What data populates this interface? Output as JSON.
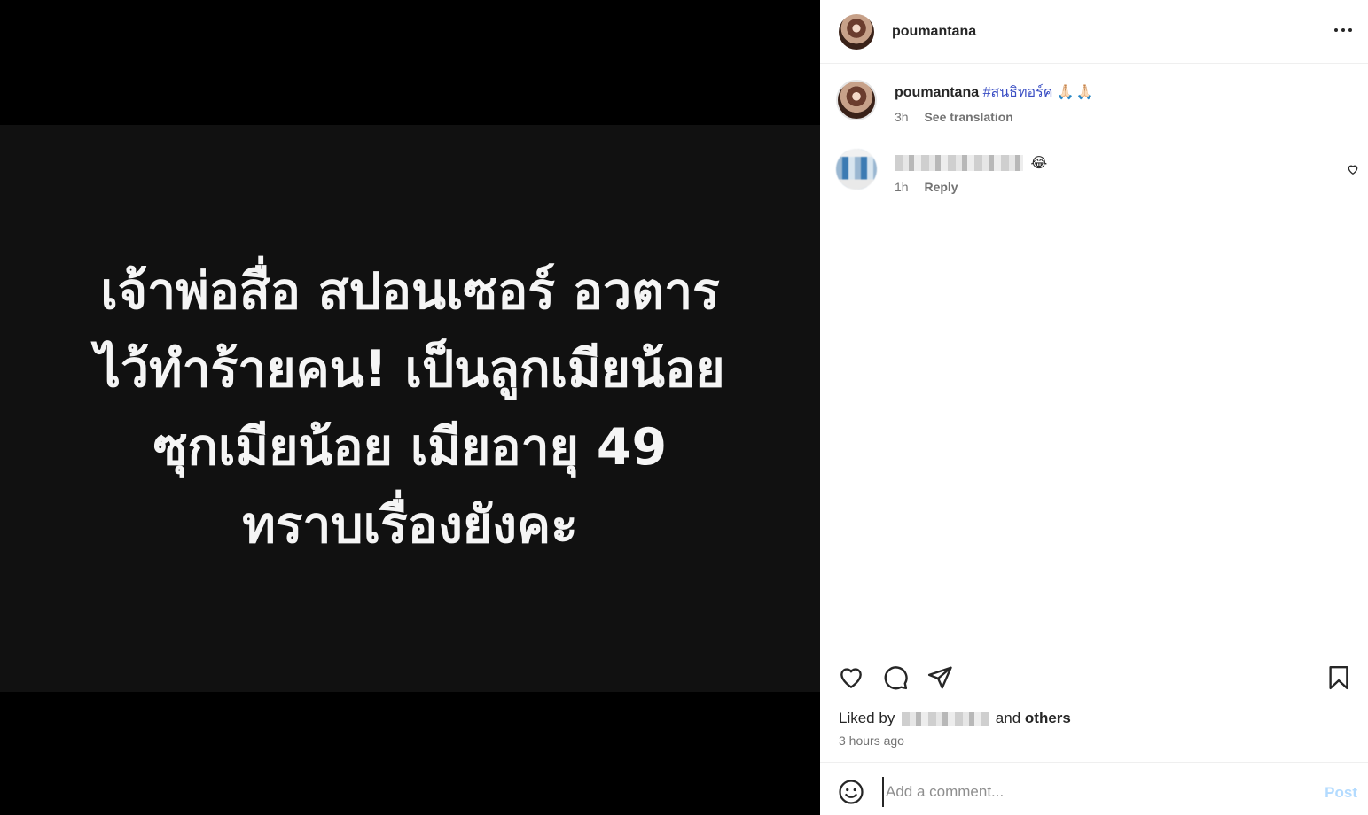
{
  "post": {
    "image_text": [
      "เจ้าพ่อสื่อ สปอนเซอร์ อวตาร",
      "ไว้ทำร้ายคน! เป็นลูกเมียน้อย",
      "ซุกเมียน้อย เมียอายุ 49",
      "ทราบเรื่องยังคะ"
    ]
  },
  "header": {
    "username": "poumantana",
    "avatar_icon": "profile-photo",
    "more_icon": "more-horizontal-icon"
  },
  "caption": {
    "username": "poumantana",
    "hashtag": "#สนธิทอร์ค",
    "emoji": "🙏🏻🙏🏻",
    "time": "3h",
    "translate_label": "See translation"
  },
  "comment": {
    "emoji": "😂",
    "time": "1h",
    "reply_label": "Reply",
    "like_icon": "heart-icon"
  },
  "actions": {
    "icons": [
      "heart-icon",
      "comment-icon",
      "share-icon",
      "bookmark-icon"
    ],
    "liked_by_prefix": "Liked by",
    "liked_by_and": "and",
    "liked_by_others": "others",
    "timestamp": "3 hours ago"
  },
  "comment_box": {
    "placeholder": "Add a comment...",
    "post_label": "Post",
    "emoji_icon": "smiley-icon"
  },
  "colors": {
    "hashtag": "#3b4fc4",
    "post_button": "#b3dbff",
    "muted": "#737373"
  }
}
